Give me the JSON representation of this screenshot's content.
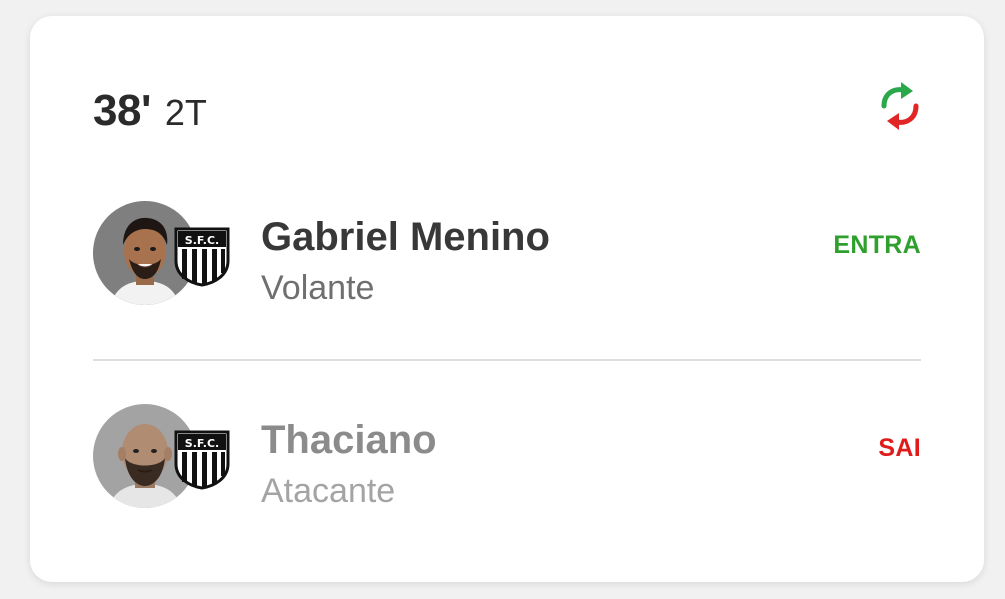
{
  "event": {
    "minute": "38'",
    "half": "2T"
  },
  "icons": {
    "swap": "substitution-arrows-icon",
    "crest": "santos-crest-icon"
  },
  "colors": {
    "in_status": "#2fa02d",
    "out_status": "#e01b1b",
    "swap_green": "#2aa84a",
    "swap_red": "#e12626"
  },
  "players": [
    {
      "name": "Gabriel Menino",
      "position": "Volante",
      "status": "ENTRA"
    },
    {
      "name": "Thaciano",
      "position": "Atacante",
      "status": "SAI"
    }
  ]
}
